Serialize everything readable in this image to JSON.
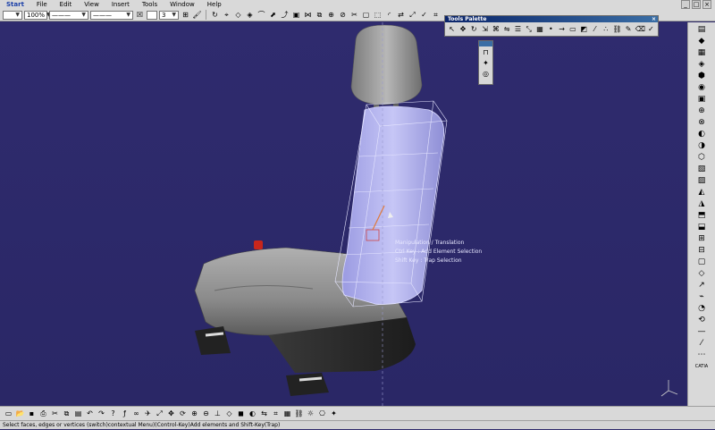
{
  "menu": {
    "items": [
      "Start",
      "File",
      "Edit",
      "View",
      "Insert",
      "Tools",
      "Window",
      "Help"
    ]
  },
  "toolbar": {
    "zoom_value": "100%",
    "line_value": "3"
  },
  "tools_palette": {
    "title": "Tools Palette"
  },
  "tooltip": {
    "lines": [
      "Manipulation / Translation",
      "Ctrl Key : Add Element Selection",
      "Shift Key : Trap Selection"
    ]
  },
  "status": {
    "text": "Select faces, edges or vertices (switch)contextual Menu)(Control-Key)Add elements and Shift-Key(Trap)"
  },
  "logo": {
    "text": "CATIA"
  },
  "colors": {
    "background": "#2e2a6b",
    "seat_grey": "#8d8d8d",
    "selection_highlight": "#b8b8f0",
    "headrest": "#9c9c9c"
  }
}
